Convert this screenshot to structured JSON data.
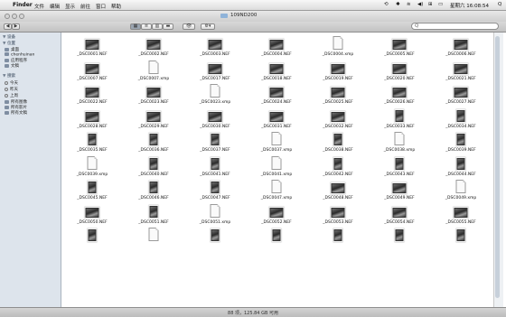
{
  "menubar": {
    "apple": "",
    "app_name": "Finder",
    "menus": [
      "文件",
      "编辑",
      "显示",
      "前往",
      "窗口",
      "帮助"
    ],
    "clock": "星期六 16:08:54",
    "search_glyph": "Q"
  },
  "window": {
    "title": "109ND200",
    "search_placeholder": "Q",
    "status": "88 项，125.84 GB 可用"
  },
  "toolbar": {
    "back": "◀",
    "forward": "▶",
    "view_modes": [
      "▦",
      "≡",
      "▥",
      "▬"
    ],
    "eye": "👁",
    "action": "⚙▾"
  },
  "sidebar": {
    "sections": [
      {
        "title": "▼ 设备",
        "items": []
      },
      {
        "title": "▼ 位置",
        "items": [
          "桌面",
          "chenhuinan",
          "应用程序",
          "文稿"
        ]
      },
      {
        "title": "▼ 搜索",
        "items": [
          "今天",
          "昨天",
          "上周",
          "所有图像",
          "所有影片",
          "所有文稿"
        ]
      }
    ]
  },
  "files": [
    {
      "name": "_DSC0001.NEF",
      "kind": "l"
    },
    {
      "name": "_DSC0002.NEF",
      "kind": "l"
    },
    {
      "name": "_DSC0003.NEF",
      "kind": "l"
    },
    {
      "name": "_DSC0004.NEF",
      "kind": "l"
    },
    {
      "name": "_DSC0004.xmp",
      "kind": "d"
    },
    {
      "name": "_DSC0005.NEF",
      "kind": "l"
    },
    {
      "name": "_DSC0006.NEF",
      "kind": "l"
    },
    {
      "name": "_DSC0007.NEF",
      "kind": "l"
    },
    {
      "name": "_DSC0007.xmp",
      "kind": "d"
    },
    {
      "name": "_DSC0017.NEF",
      "kind": "l"
    },
    {
      "name": "_DSC0018.NEF",
      "kind": "l"
    },
    {
      "name": "_DSC0019.NEF",
      "kind": "l"
    },
    {
      "name": "_DSC0020.NEF",
      "kind": "l"
    },
    {
      "name": "_DSC0021.NEF",
      "kind": "l"
    },
    {
      "name": "_DSC0022.NEF",
      "kind": "l"
    },
    {
      "name": "_DSC0023.NEF",
      "kind": "l"
    },
    {
      "name": "_DSC0023.xmp",
      "kind": "d"
    },
    {
      "name": "_DSC0024.NEF",
      "kind": "l"
    },
    {
      "name": "_DSC0025.NEF",
      "kind": "l"
    },
    {
      "name": "_DSC0026.NEF",
      "kind": "l"
    },
    {
      "name": "_DSC0027.NEF",
      "kind": "l"
    },
    {
      "name": "_DSC0028.NEF",
      "kind": "l"
    },
    {
      "name": "_DSC0029.NEF",
      "kind": "l"
    },
    {
      "name": "_DSC0030.NEF",
      "kind": "l"
    },
    {
      "name": "_DSC0031.NEF",
      "kind": "l"
    },
    {
      "name": "_DSC0032.NEF",
      "kind": "l"
    },
    {
      "name": "_DSC0033.NEF",
      "kind": "p"
    },
    {
      "name": "_DSC0034.NEF",
      "kind": "p"
    },
    {
      "name": "_DSC0035.NEF",
      "kind": "p"
    },
    {
      "name": "_DSC0036.NEF",
      "kind": "p"
    },
    {
      "name": "_DSC0037.NEF",
      "kind": "p"
    },
    {
      "name": "_DSC0037.xmp",
      "kind": "d"
    },
    {
      "name": "_DSC0038.NEF",
      "kind": "p"
    },
    {
      "name": "_DSC0038.xmp",
      "kind": "d"
    },
    {
      "name": "_DSC0039.NEF",
      "kind": "p"
    },
    {
      "name": "_DSC0039.xmp",
      "kind": "d"
    },
    {
      "name": "_DSC0040.NEF",
      "kind": "p"
    },
    {
      "name": "_DSC0041.NEF",
      "kind": "p"
    },
    {
      "name": "_DSC0041.xmp",
      "kind": "d"
    },
    {
      "name": "_DSC0042.NEF",
      "kind": "p"
    },
    {
      "name": "_DSC0043.NEF",
      "kind": "p"
    },
    {
      "name": "_DSC0044.NEF",
      "kind": "p"
    },
    {
      "name": "_DSC0045.NEF",
      "kind": "p"
    },
    {
      "name": "_DSC0046.NEF",
      "kind": "p"
    },
    {
      "name": "_DSC0047.NEF",
      "kind": "p"
    },
    {
      "name": "_DSC0047.xmp",
      "kind": "d"
    },
    {
      "name": "_DSC0048.NEF",
      "kind": "l"
    },
    {
      "name": "_DSC0049.NEF",
      "kind": "l"
    },
    {
      "name": "_DSC0049.xmp",
      "kind": "d"
    },
    {
      "name": "_DSC0050.NEF",
      "kind": "l"
    },
    {
      "name": "_DSC0051.NEF",
      "kind": "p"
    },
    {
      "name": "_DSC0051.xmp",
      "kind": "d"
    },
    {
      "name": "_DSC0052.NEF",
      "kind": "l"
    },
    {
      "name": "_DSC0053.NEF",
      "kind": "l"
    },
    {
      "name": "_DSC0054.NEF",
      "kind": "l"
    },
    {
      "name": "_DSC0055.NEF",
      "kind": "l"
    },
    {
      "name": "",
      "kind": "p"
    },
    {
      "name": "",
      "kind": "d"
    },
    {
      "name": "",
      "kind": "p"
    },
    {
      "name": "",
      "kind": "p"
    },
    {
      "name": "",
      "kind": "p"
    },
    {
      "name": "",
      "kind": "p"
    },
    {
      "name": "",
      "kind": "p"
    }
  ]
}
